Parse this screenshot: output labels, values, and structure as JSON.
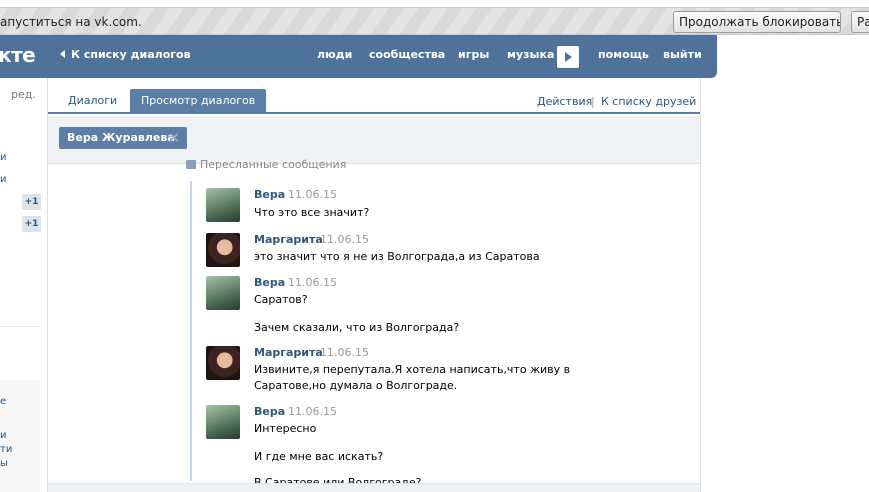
{
  "browser": {
    "infobar_message": "апуститься на vk.com.",
    "continue_blocking": "Продолжать блокировать",
    "second_button": "Ра"
  },
  "header": {
    "logo_fragment": "кте",
    "back_link": "К списку диалогов",
    "nav": [
      "люди",
      "сообщества",
      "игры",
      "музыка",
      "помощь",
      "выйти"
    ]
  },
  "sidebar": {
    "edit_label": "ред.",
    "fragments": [
      "и",
      "и"
    ],
    "badges": [
      "+1",
      "+1"
    ],
    "box_fragments": [
      "е",
      "и",
      "ти",
      "ы"
    ]
  },
  "tabs": {
    "dialogs": "Диалоги",
    "view_dialogs": "Просмотр диалогов",
    "actions": "Действия",
    "separator": "|",
    "to_friends": "К списку друзей"
  },
  "recipient": {
    "name": "Вера Журавлева",
    "close_icon": "×"
  },
  "forwarded_header": "Пересланные сообщения",
  "messages": [
    {
      "author": "Вера",
      "date": "11.06.15",
      "lines": [
        "Что это все значит?"
      ]
    },
    {
      "author": "Маргарита",
      "date": "11.06.15",
      "lines": [
        "это значит что я не из Волгограда,а из Саратова"
      ]
    },
    {
      "author": "Вера",
      "date": "11.06.15",
      "lines": [
        "Саратов?",
        "Зачем сказали, что из Волгограда?"
      ]
    },
    {
      "author": "Маргарита",
      "date": "11.06.15",
      "lines": [
        "Извините,я перепутала.Я хотела написать,что живу в",
        "Саратове,но думала о Волгограде."
      ]
    },
    {
      "author": "Вера",
      "date": "11.06.15",
      "lines": [
        "Интересно",
        "И где мне вас искать?",
        "В Саратове или Волгограде?"
      ]
    }
  ]
}
